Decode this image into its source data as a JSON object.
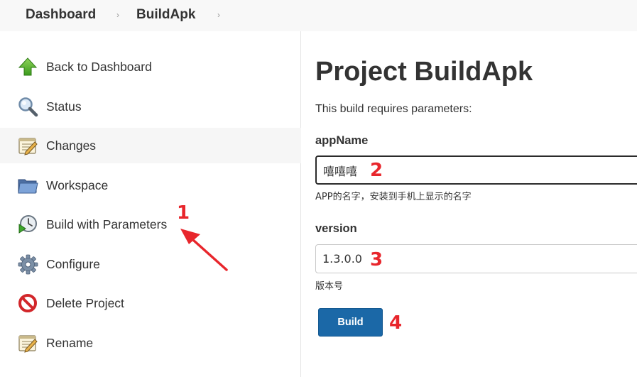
{
  "breadcrumb": {
    "items": [
      "Dashboard",
      "BuildApk"
    ],
    "separator": "›"
  },
  "sidebar": {
    "items": [
      {
        "label": "Back to Dashboard",
        "icon": "up-arrow-icon"
      },
      {
        "label": "Status",
        "icon": "magnifier-icon"
      },
      {
        "label": "Changes",
        "icon": "notepad-icon",
        "active": true
      },
      {
        "label": "Workspace",
        "icon": "folder-icon"
      },
      {
        "label": "Build with Parameters",
        "icon": "clock-play-icon"
      },
      {
        "label": "Configure",
        "icon": "gear-icon"
      },
      {
        "label": "Delete Project",
        "icon": "no-entry-icon"
      },
      {
        "label": "Rename",
        "icon": "notepad-icon"
      }
    ]
  },
  "main": {
    "title": "Project BuildApk",
    "description": "This build requires parameters:",
    "params": [
      {
        "name": "appName",
        "value": "嘻嘻嘻",
        "help": "APP的名字，安装到手机上显示的名字"
      },
      {
        "name": "version",
        "value": "1.3.0.0",
        "help": "版本号"
      }
    ],
    "build_label": "Build"
  },
  "annotations": [
    "1",
    "2",
    "3",
    "4"
  ],
  "colors": {
    "annotation": "#e8262c",
    "button": "#1b68a7",
    "breadcrumb_bg": "#f8f8f8",
    "active_row": "#f6f6f6"
  }
}
